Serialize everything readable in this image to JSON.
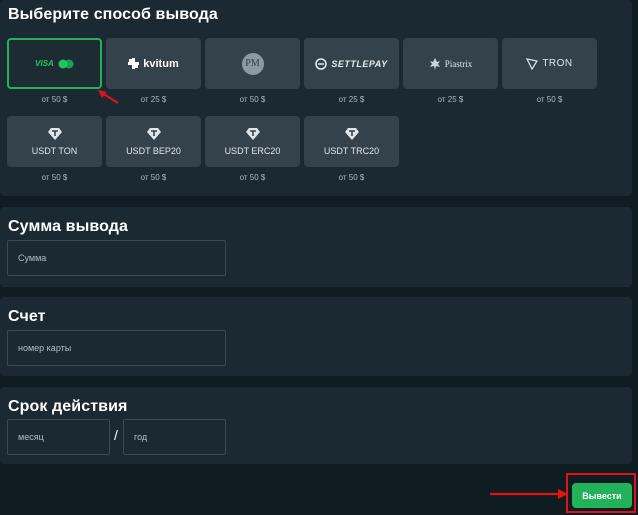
{
  "methods_section": {
    "title": "Выберите способ вывода",
    "methods": [
      {
        "id": "visa",
        "brand": "VISA",
        "min": "от 50 $",
        "selected": true
      },
      {
        "id": "kvitum",
        "brand": "kvitum",
        "min": "от 25 $"
      },
      {
        "id": "pm",
        "brand": "PM",
        "min": "от 50 $"
      },
      {
        "id": "settlepay",
        "brand": "SETTLEPAY",
        "min": "от 25 $"
      },
      {
        "id": "piastrix",
        "brand": "Piastrix",
        "min": "от 25 $"
      },
      {
        "id": "tron",
        "brand": "TRON",
        "min": "от 50 $"
      },
      {
        "id": "usdt-ton",
        "label": "USDT TON",
        "min": "от 50 $"
      },
      {
        "id": "usdt-bep20",
        "label": "USDT BEP20",
        "min": "от 50 $"
      },
      {
        "id": "usdt-erc20",
        "label": "USDT ERC20",
        "min": "от 50 $"
      },
      {
        "id": "usdt-trc20",
        "label": "USDT TRC20",
        "min": "от 50 $"
      }
    ]
  },
  "amount_section": {
    "title": "Сумма вывода",
    "placeholder": "Сумма"
  },
  "account_section": {
    "title": "Счет",
    "placeholder": "номер карты"
  },
  "expiry_section": {
    "title": "Срок действия",
    "month_placeholder": "месяц",
    "separator": "/",
    "year_placeholder": "год"
  },
  "submit": {
    "label": "Вывести"
  },
  "colors": {
    "accent": "#22b35a",
    "annotation": "#e11414",
    "panel": "#1b2a32",
    "tile": "#34434b",
    "background": "#0f1c22"
  }
}
